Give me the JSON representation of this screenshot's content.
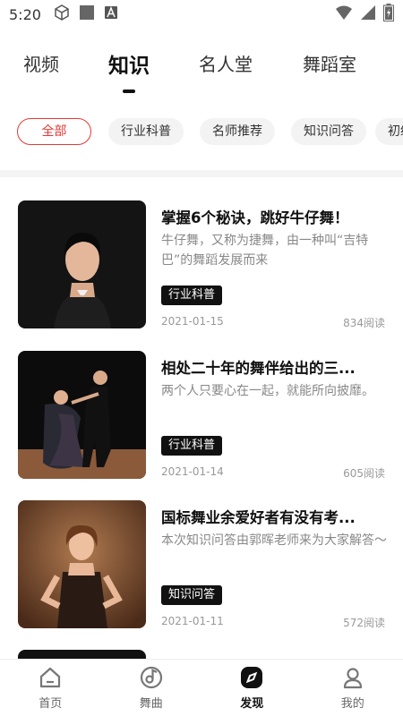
{
  "status_bar": {
    "time": "5:20"
  },
  "top_tabs": [
    {
      "label": "视频"
    },
    {
      "label": "知识"
    },
    {
      "label": "名人堂"
    },
    {
      "label": "舞蹈室"
    }
  ],
  "chips": [
    {
      "label": "全部"
    },
    {
      "label": "行业科普"
    },
    {
      "label": "名师推荐"
    },
    {
      "label": "知识问答"
    },
    {
      "label": "初级"
    }
  ],
  "articles": [
    {
      "title": "掌握6个秘诀，跳好牛仔舞！",
      "desc": "牛仔舞，又称为捷舞，由一种叫“吉特巴”的舞蹈发展而来",
      "tag": "行业科普",
      "date": "2021-01-15",
      "reads": "834阅读"
    },
    {
      "title": "相处二十年的舞伴给出的三...",
      "desc": "两个人只要心在一起，就能所向披靡。",
      "tag": "行业科普",
      "date": "2021-01-14",
      "reads": "605阅读"
    },
    {
      "title": "国标舞业余爱好者有没有考...",
      "desc": "本次知识问答由郭晖老师来为大家解答～",
      "tag": "知识问答",
      "date": "2021-01-11",
      "reads": "572阅读"
    }
  ],
  "bottom_nav": [
    {
      "label": "首页"
    },
    {
      "label": "舞曲"
    },
    {
      "label": "发现"
    },
    {
      "label": "我的"
    }
  ],
  "colors": {
    "accent": "#e53935",
    "tag_bg": "#111111",
    "text_primary": "#111111",
    "text_secondary": "#888888"
  }
}
